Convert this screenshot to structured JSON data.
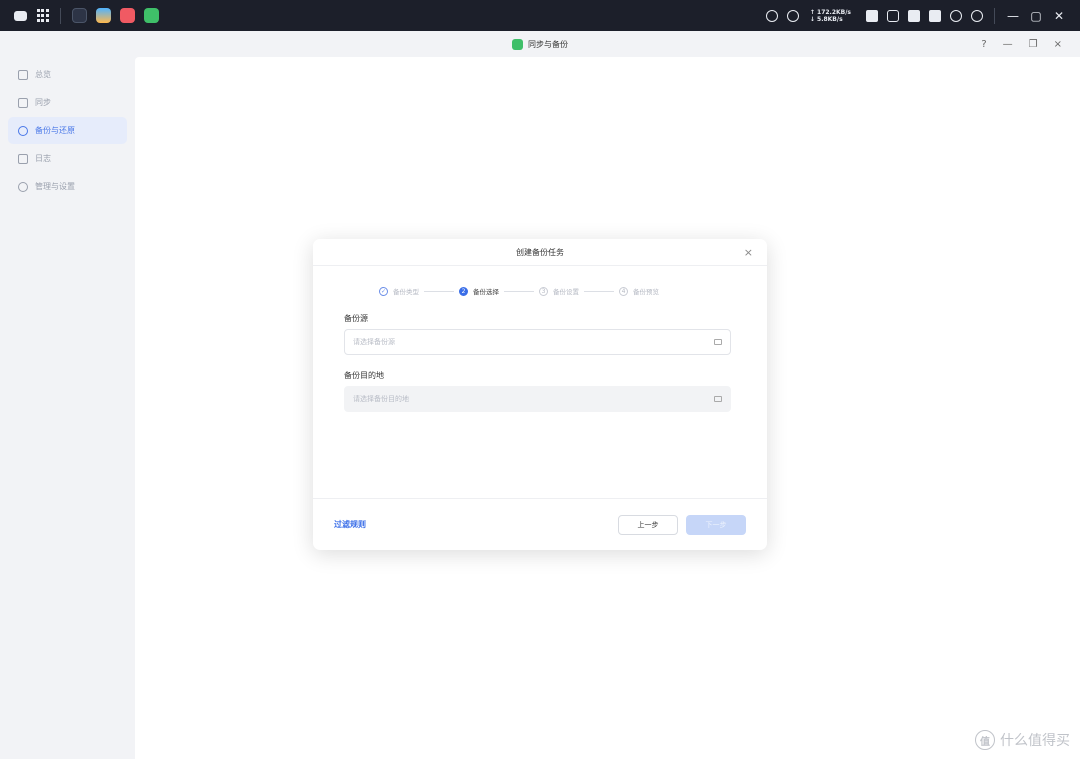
{
  "system_bar": {
    "speed_up": "↑ 172.2KB/s",
    "speed_down": "↓ 5.8KB/s"
  },
  "window": {
    "title": "同步与备份",
    "help": "?",
    "minimize": "—",
    "restore": "❐"
  },
  "sidebar": {
    "items": [
      {
        "label": "总览"
      },
      {
        "label": "同步"
      },
      {
        "label": "备份与还原"
      },
      {
        "label": "日志"
      },
      {
        "label": "管理与设置"
      }
    ]
  },
  "dialog": {
    "title": "创建备份任务",
    "close": "×",
    "steps": [
      {
        "label": "备份类型",
        "state": "done"
      },
      {
        "label": "备份选择",
        "state": "current"
      },
      {
        "label": "备份设置",
        "state": "pending"
      },
      {
        "label": "备份预览",
        "state": "pending"
      }
    ],
    "source_label": "备份源",
    "source_placeholder": "请选择备份源",
    "target_label": "备份目的地",
    "target_placeholder": "请选择备份目的地",
    "rules_link": "过滤规则",
    "prev_button": "上一步",
    "next_button": "下一步"
  },
  "watermark": {
    "text": "什么值得买",
    "badge": "值"
  },
  "colors": {
    "accent": "#3a6ee8",
    "topbar": "#1c1f2a",
    "sidebar_active_bg": "#e6ecfb"
  }
}
